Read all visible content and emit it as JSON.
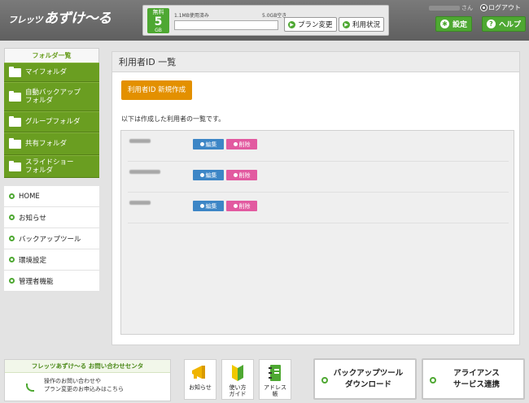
{
  "header": {
    "logo_small": "フレッツ",
    "logo_main": "あずけ〜る",
    "plan": {
      "label_top": "無料",
      "size": "5",
      "unit": "GB"
    },
    "usage": {
      "used_text": "1.1MB使用済み",
      "free_text": "5.0GB空き",
      "used_fraction": 0.0002
    },
    "plan_change_label": "プラン変更",
    "usage_status_label": "利用状況",
    "user_suffix": "さん",
    "logout_label": "ログアウト",
    "settings_label": "設定",
    "help_label": "ヘルプ"
  },
  "folders": {
    "title": "フォルダ一覧",
    "items": [
      {
        "label": "マイフォルダ"
      },
      {
        "label": "自動バックアップ\nフォルダ"
      },
      {
        "label": "グループフォルダ"
      },
      {
        "label": "共有フォルダ"
      },
      {
        "label": "スライドショー\nフォルダ"
      }
    ]
  },
  "nav": {
    "items": [
      {
        "label": "HOME"
      },
      {
        "label": "お知らせ"
      },
      {
        "label": "バックアップツール"
      },
      {
        "label": "環境設定"
      },
      {
        "label": "管理者機能"
      }
    ]
  },
  "main": {
    "title": "利用者ID 一覧",
    "new_button": "利用者ID 新規作成",
    "description": "以下は作成した利用者の一覧です。",
    "edit_label": "編集",
    "delete_label": "削除"
  },
  "footer": {
    "contact_title": "フレッツあずけ〜る お問い合わせセンタ",
    "contact_line1": "操作のお問い合わせや",
    "contact_line2": "プラン変更のお申込みはこちら",
    "news_label": "お知らせ",
    "guide_label1": "使い方",
    "guide_label2": "ガイド",
    "address_label1": "アドレス",
    "address_label2": "帳",
    "backup_dl_line1": "バックアップツール",
    "backup_dl_line2": "ダウンロード",
    "alliance_line1": "アライアンス",
    "alliance_line2": "サービス連携"
  },
  "colors": {
    "green": "#4ea832",
    "folder_green": "#6a9e21",
    "orange": "#e39000",
    "edit_blue": "#3d86c6",
    "delete_pink": "#e25aa0"
  }
}
